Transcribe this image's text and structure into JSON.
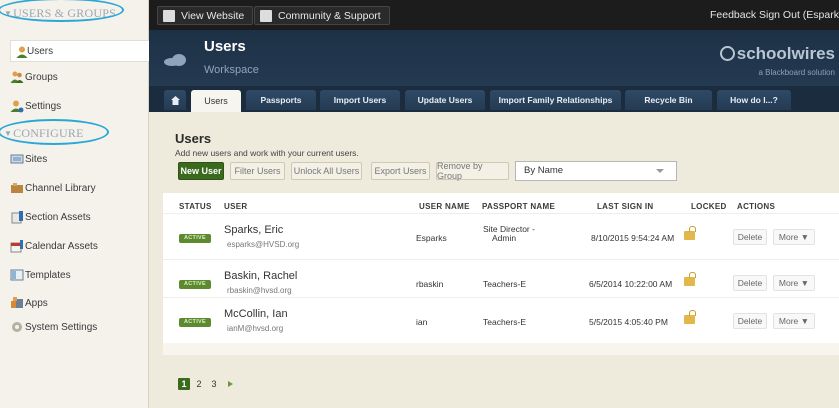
{
  "sidebar": {
    "sections": [
      {
        "label": "USERS & GROUPS",
        "items": [
          {
            "label": "Users",
            "icon": "user-icon",
            "active": true
          },
          {
            "label": "Groups",
            "icon": "group-icon"
          },
          {
            "label": "Settings",
            "icon": "user-settings-icon"
          }
        ]
      },
      {
        "label": "CONFIGURE",
        "items": [
          {
            "label": "Sites",
            "icon": "sites-icon"
          },
          {
            "label": "Channel Library",
            "icon": "channel-library-icon"
          },
          {
            "label": "Section Assets",
            "icon": "section-assets-icon"
          },
          {
            "label": "Calendar Assets",
            "icon": "calendar-assets-icon"
          },
          {
            "label": "Templates",
            "icon": "templates-icon"
          },
          {
            "label": "Apps",
            "icon": "apps-icon"
          },
          {
            "label": "System Settings",
            "icon": "gear-icon"
          }
        ]
      }
    ]
  },
  "topbar": {
    "view_website": "View Website",
    "community": "Community & Support",
    "feedback": "Feedback",
    "sign_out": "Sign Out (Esparks)"
  },
  "header": {
    "title": "Users",
    "subtitle": "Workspace",
    "brand": "schoolwires",
    "brand_sub": "a Blackboard solution"
  },
  "tabs": [
    "Users",
    "Passports",
    "Import Users",
    "Update Users",
    "Import Family Relationships",
    "Recycle Bin",
    "How do I...?"
  ],
  "main": {
    "title": "Users",
    "subtitle": "Add new users and work with your current users.",
    "toolbar": {
      "new_user": "New User",
      "filter": "Filter Users",
      "unlock": "Unlock All Users",
      "export": "Export Users",
      "remove": "Remove by Group",
      "sort_value": "By Name"
    },
    "columns": [
      "STATUS",
      "USER",
      "USER NAME",
      "PASSPORT NAME",
      "LAST SIGN IN",
      "LOCKED",
      "ACTIONS"
    ],
    "rows": [
      {
        "status": "ACTIVE",
        "name": "Sparks, Eric",
        "email": "esparks@HVSD.org",
        "username": "Esparks",
        "passport_1": "Site Director -",
        "passport_2": "Admin",
        "last_sign_in": "8/10/2015 9:54:24 AM",
        "delete": "Delete",
        "more": "More ▼"
      },
      {
        "status": "ACTIVE",
        "name": "Baskin, Rachel",
        "email": "rbaskin@hvsd.org",
        "username": "rbaskin",
        "passport_1": "Teachers-E",
        "passport_2": "",
        "last_sign_in": "6/5/2014 10:22:00 AM",
        "delete": "Delete",
        "more": "More ▼"
      },
      {
        "status": "ACTIVE",
        "name": "McCollin, Ian",
        "email": "ianM@hvsd.org",
        "username": "ian",
        "passport_1": "Teachers-E",
        "passport_2": "",
        "last_sign_in": "5/5/2015 4:05:40 PM",
        "delete": "Delete",
        "more": "More ▼"
      }
    ],
    "pagination": {
      "pages": [
        "1",
        "2",
        "3"
      ],
      "current": "1"
    }
  }
}
